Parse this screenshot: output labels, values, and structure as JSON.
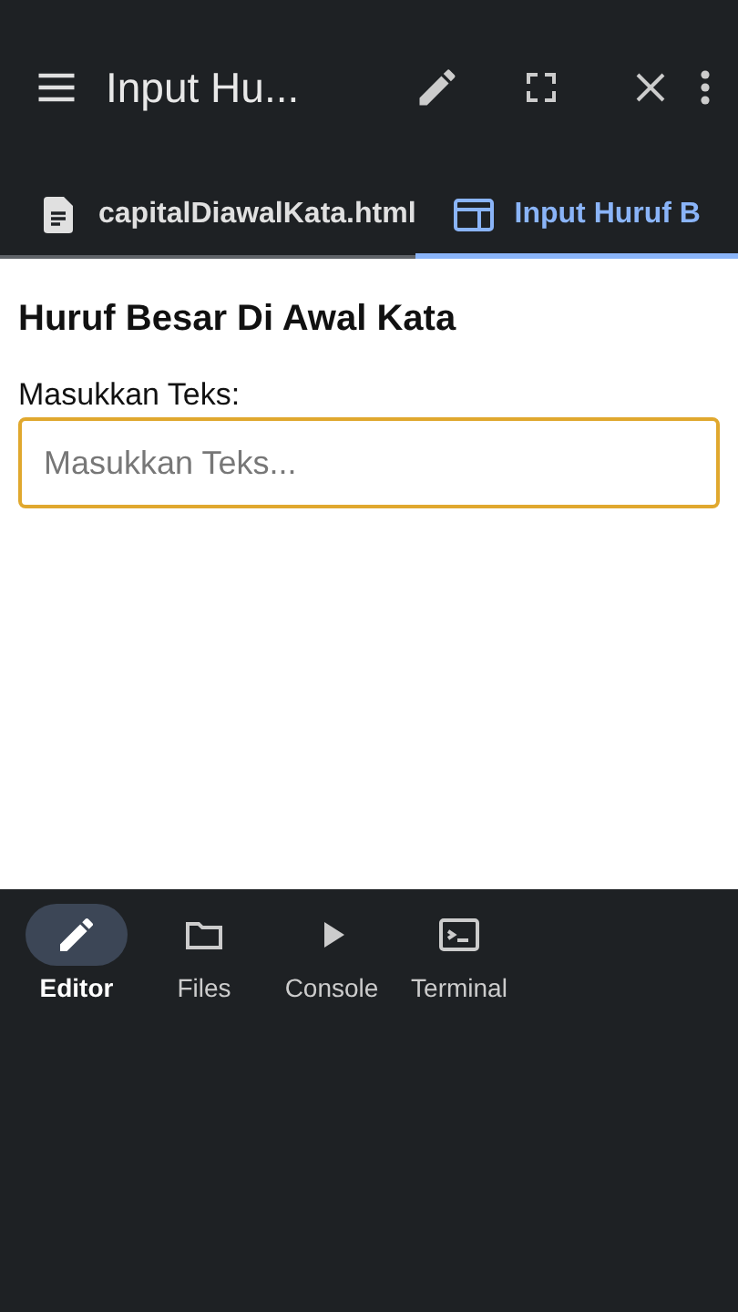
{
  "app_bar": {
    "title": "Input Hu..."
  },
  "tabs": [
    {
      "label": "capitalDiawalKata.html",
      "kind": "file",
      "selected": false
    },
    {
      "label": "Input Huruf B",
      "kind": "preview",
      "selected": true
    }
  ],
  "preview": {
    "heading": "Huruf Besar Di Awal Kata",
    "field_label": "Masukkan Teks:",
    "field": {
      "placeholder": "Masukkan Teks..."
    }
  },
  "bottom_nav": [
    {
      "label": "Editor",
      "kind": "editor",
      "selected": true
    },
    {
      "label": "Files",
      "kind": "files",
      "selected": false
    },
    {
      "label": "Console",
      "kind": "console",
      "selected": false
    },
    {
      "label": "Terminal",
      "kind": "terminal",
      "selected": false
    }
  ]
}
